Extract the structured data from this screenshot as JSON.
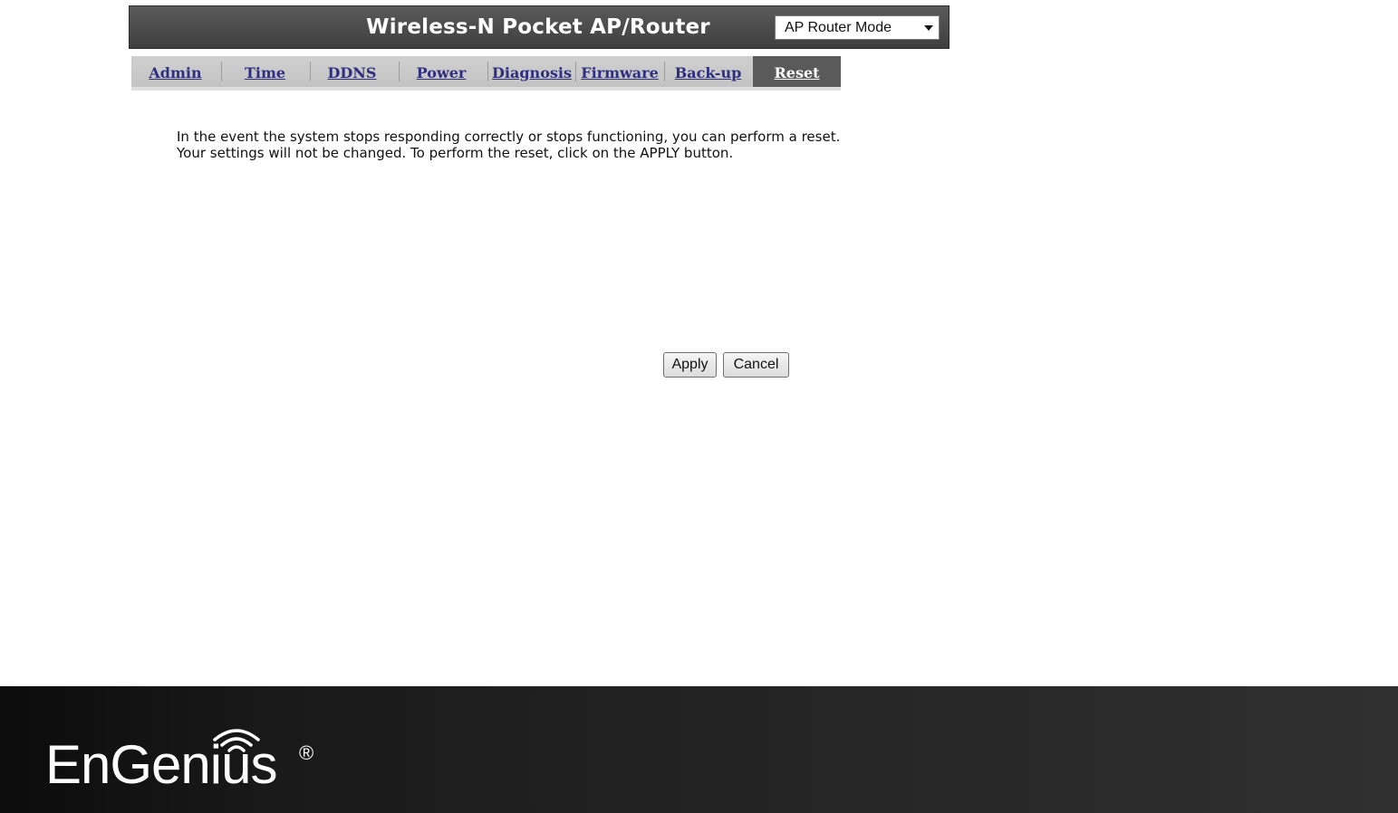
{
  "header": {
    "title": "Wireless-N Pocket AP/Router",
    "mode_select": {
      "value": "AP Router Mode"
    }
  },
  "tabs": [
    {
      "label": "Admin",
      "active": false
    },
    {
      "label": "Time",
      "active": false
    },
    {
      "label": "DDNS",
      "active": false
    },
    {
      "label": "Power",
      "active": false
    },
    {
      "label": "Diagnosis",
      "active": false
    },
    {
      "label": "Firmware",
      "active": false
    },
    {
      "label": "Back-up",
      "active": false
    },
    {
      "label": "Reset",
      "active": true
    }
  ],
  "content": {
    "description_line1": "In the event the system stops responding correctly or stops functioning, you can perform a reset.",
    "description_line2": "Your settings will not be changed. To perform the reset, click on the APPLY button."
  },
  "buttons": {
    "apply_label": "Apply",
    "cancel_label": "Cancel"
  },
  "footer": {
    "logo_text": "EnGenius",
    "logo_registered": "®",
    "logo_icon": "wifi-icon"
  },
  "colors": {
    "header_bg": "#4a4a4a",
    "tab_bar_bg": "#c9c9c9",
    "tab_active_bg": "#5a5a5a",
    "tab_link": "#2f2f7f",
    "footer_bg": "#1e1e1e"
  }
}
